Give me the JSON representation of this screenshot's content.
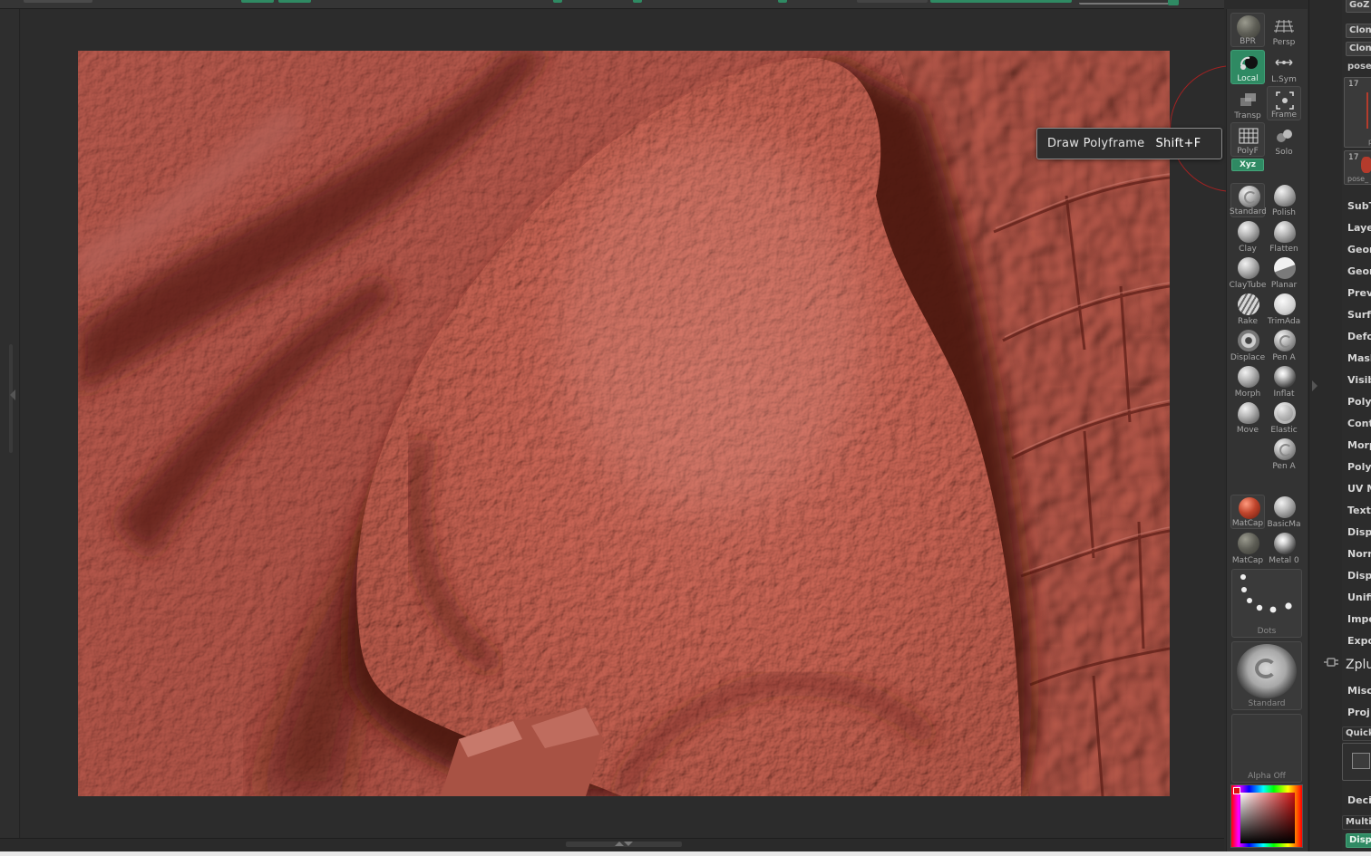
{
  "shelf": {
    "buttons": [
      {
        "id": "bpr",
        "label": "BPR",
        "active": false
      },
      {
        "id": "persp",
        "label": "Persp",
        "active": false
      },
      {
        "id": "local",
        "label": "Local",
        "active": true
      },
      {
        "id": "lsym",
        "label": "L.Sym",
        "active": false
      },
      {
        "id": "transp",
        "label": "Transp",
        "active": false
      },
      {
        "id": "frame",
        "label": "Frame",
        "active": false
      },
      {
        "id": "polyf",
        "label": "PolyF",
        "active": false
      },
      {
        "id": "solo",
        "label": "Solo",
        "active": false
      }
    ],
    "xyz_label": "Xyz",
    "brushes": [
      {
        "label": "Standard",
        "icon": "standard-brush-icon"
      },
      {
        "label": "Polish",
        "icon": "polish-brush-icon"
      },
      {
        "label": "Clay",
        "icon": "clay-brush-icon"
      },
      {
        "label": "Flatten",
        "icon": "flatten-brush-icon"
      },
      {
        "label": "ClayTube",
        "icon": "claytubes-brush-icon"
      },
      {
        "label": "Planar",
        "icon": "planar-brush-icon"
      },
      {
        "label": "Rake",
        "icon": "rake-brush-icon"
      },
      {
        "label": "TrimAda",
        "icon": "trimadaptive-brush-icon"
      },
      {
        "label": "Displace",
        "icon": "displace-brush-icon"
      },
      {
        "label": "Pen A",
        "icon": "pen-a-brush-icon"
      },
      {
        "label": "Morph",
        "icon": "morph-brush-icon"
      },
      {
        "label": "Inflat",
        "icon": "inflate-brush-icon"
      },
      {
        "label": "Move",
        "icon": "move-brush-icon"
      },
      {
        "label": "Elastic",
        "icon": "elastic-brush-icon"
      },
      {
        "label": "Pen A",
        "icon": "pen-a-brush-icon"
      }
    ],
    "materials": [
      {
        "label": "MatCap",
        "icon": "matcap-red-material-icon"
      },
      {
        "label": "BasicMa",
        "icon": "basic-material-icon"
      },
      {
        "label": "MatCap",
        "icon": "matcap-gray-material-icon"
      },
      {
        "label": "Metal 0",
        "icon": "metal-material-icon"
      }
    ],
    "stroke_label": "Dots",
    "brush_label": "Standard",
    "alpha_label": "Alpha  Off"
  },
  "tooltip": {
    "text": "Draw Polyframe",
    "shortcut": "Shift+F"
  },
  "palette": {
    "top_items": [
      {
        "label": "GoZ",
        "type": "button"
      },
      {
        "label": "Clone",
        "type": "button"
      },
      {
        "label": "Clone",
        "type": "button"
      },
      {
        "label": "pose",
        "type": "text"
      }
    ],
    "thumbs": [
      {
        "num": "17",
        "caption": "po"
      },
      {
        "num": "17",
        "caption": "pose_"
      }
    ],
    "menu": [
      "SubT",
      "Laye",
      "Geon",
      "Geon",
      "Prev",
      "Surf",
      "Defo",
      "Mask",
      "Visib",
      "Poly",
      "Cont",
      "Morp",
      "Poly",
      "UV M",
      "Text",
      "Displ",
      "Norn",
      "Displ",
      "Unifi",
      "Impo",
      "Expo"
    ],
    "zplugin_label": "Zplu",
    "lower_menu": [
      "Misc",
      "Proj"
    ],
    "quick_label": "Quick",
    "lower_menu2": [
      "Deci"
    ],
    "multi_label": "Multi",
    "displ_button": "Displ"
  },
  "colors": {
    "accent_green": "#2f8a63",
    "sculpt_red": "#8a3a30",
    "tooltip_border": "#8a8a8a"
  }
}
